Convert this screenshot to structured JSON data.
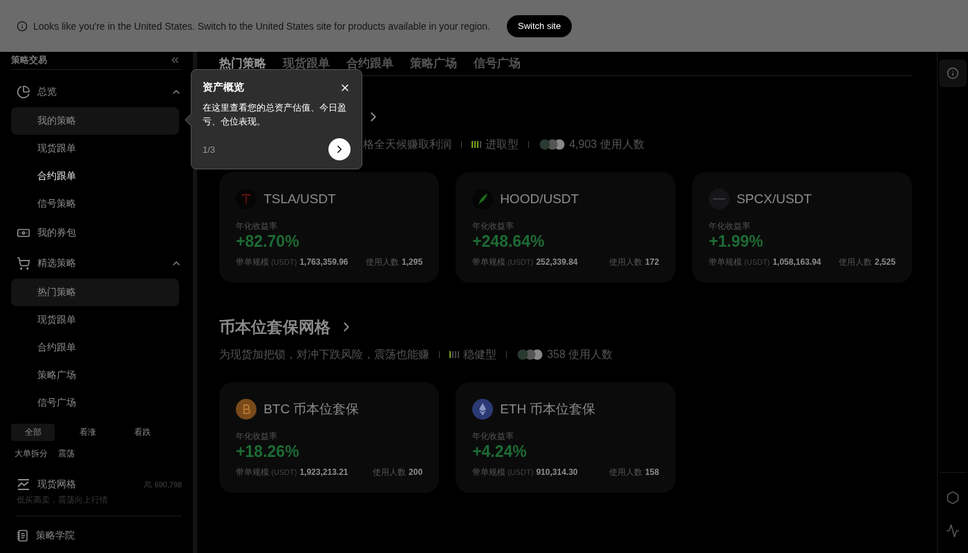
{
  "banner": {
    "message": "Looks like you're in the United States. Switch to the United States site for products available in your region.",
    "button": "Switch site"
  },
  "sidebar": {
    "title": "策略交易",
    "nav": [
      {
        "kind": "group",
        "label": "总览",
        "expanded": true,
        "children": [
          {
            "label": "我的策略",
            "selected": true,
            "highlighted": false
          },
          {
            "label": "现货跟单",
            "selected": false,
            "highlighted": false
          },
          {
            "label": "合约跟单",
            "selected": false,
            "highlighted": true
          },
          {
            "label": "信号策略",
            "selected": false,
            "highlighted": false
          }
        ]
      },
      {
        "kind": "link",
        "label": "我的券包"
      },
      {
        "kind": "group",
        "label": "精选策略",
        "expanded": true,
        "children": [
          {
            "label": "热门策略",
            "selected": true,
            "highlighted": false
          },
          {
            "label": "现货跟单",
            "selected": false,
            "highlighted": false
          },
          {
            "label": "合约跟单",
            "selected": false,
            "highlighted": false
          },
          {
            "label": "策略广场",
            "selected": false,
            "highlighted": false
          },
          {
            "label": "信号广场",
            "selected": false,
            "highlighted": false
          }
        ]
      }
    ],
    "filters": [
      {
        "label": "全部",
        "selected": true
      },
      {
        "label": "看涨",
        "selected": false
      },
      {
        "label": "看跌",
        "selected": false
      },
      {
        "label": "大单拆分",
        "selected": false
      },
      {
        "label": "震荡",
        "selected": false
      }
    ],
    "strategy": {
      "name": "现货网格",
      "count": "690,798",
      "description": "低买高卖，震荡向上行情"
    },
    "footer_link": "策略学院"
  },
  "tabs": [
    {
      "label": "热门策略",
      "selected": true
    },
    {
      "label": "现货跟单",
      "selected": false
    },
    {
      "label": "合约跟单",
      "selected": false
    },
    {
      "label": "策略广场",
      "selected": false
    },
    {
      "label": "信号广场",
      "selected": false
    }
  ],
  "sections": [
    {
      "subtitle": "格全天候赚取利润",
      "risk": {
        "label": "进取型",
        "level": 0.75
      },
      "users": "4,903 使用人数",
      "cards": [
        {
          "pair": "TSLA/USDT",
          "yield_label": "年化收益率",
          "yield": "+82.70%",
          "volume_label": "带单规模",
          "volume_unit": "(USDT)",
          "volume": "1,763,359.96",
          "users_label": "使用人数",
          "users": "1,295"
        },
        {
          "pair": "HOOD/USDT",
          "yield_label": "年化收益率",
          "yield": "+248.64%",
          "volume_label": "带单规模",
          "volume_unit": "(USDT)",
          "volume": "252,339.84",
          "users_label": "使用人数",
          "users": "172"
        },
        {
          "pair": "SPCX/USDT",
          "yield_label": "年化收益率",
          "yield": "+1.99%",
          "volume_label": "带单规模",
          "volume_unit": "(USDT)",
          "volume": "1,058,163.94",
          "users_label": "使用人数",
          "users": "2,525"
        }
      ]
    },
    {
      "title": "币本位套保网格",
      "subtitle": "为现货加把锁，对冲下跌风险，震荡也能赚",
      "risk": {
        "label": "稳健型",
        "level": 0.25
      },
      "users": "358 使用人数",
      "cards": [
        {
          "pair": "BTC 币本位套保",
          "yield_label": "年化收益率",
          "yield": "+18.26%",
          "volume_label": "带单规模",
          "volume_unit": "(USDT)",
          "volume": "1,923,213.21",
          "users_label": "使用人数",
          "users": "200"
        },
        {
          "pair": "ETH 币本位套保",
          "yield_label": "年化收益率",
          "yield": "+4.24%",
          "volume_label": "带单规模",
          "volume_unit": "(USDT)",
          "volume": "910,314.30",
          "users_label": "使用人数",
          "users": "158"
        }
      ]
    }
  ],
  "tooltip": {
    "title": "资产概览",
    "body": "在这里查看您的总资产估值、今日盈亏、仓位表现。",
    "step": "1/3"
  }
}
